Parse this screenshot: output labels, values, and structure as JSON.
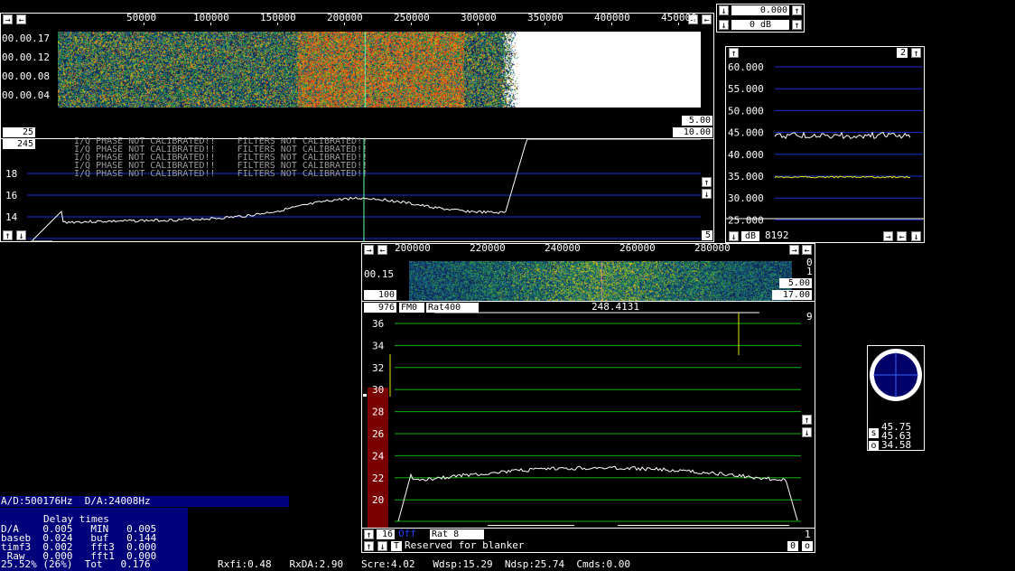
{
  "colors": {
    "grid_blue": "#1a2fd0",
    "grid_green": "#10b010",
    "trace": "#ffffff",
    "yellow_trace": "#e6e600",
    "red_bar": "#7a0000",
    "status_bg": "#00007a",
    "warning_text": "#9a9a9a"
  },
  "wide": {
    "freq_ticks": [
      "50000",
      "100000",
      "150000",
      "200000",
      "250000",
      "300000",
      "350000",
      "400000",
      "450000"
    ],
    "time_labels": [
      "00.00.17",
      "00.00.12",
      "00.00.08",
      "00.00.04"
    ],
    "box_left": "25",
    "box_right_top": "5.00",
    "box_right_bottom": "10.00",
    "box_top_left": "245",
    "warnings": [
      "I/Q PHASE NOT CALIBRATED!!    FILTERS NOT CALIBRATED!!",
      "I/Q PHASE NOT CALIBRATED!!    FILTERS NOT CALIBRATED!!",
      "I/Q PHASE NOT CALIBRATED!!    FILTERS NOT CALIBRATED!!",
      "I/Q PHASE NOT CALIBRATED!!    FILTERS NOT CALIBRATED!!",
      "I/Q PHASE NOT CALIBRATED!!    FILTERS NOT CALIBRATED!!"
    ],
    "y_labels": [
      "18",
      "16",
      "14"
    ],
    "box_bottom_right": "5"
  },
  "top_right": {
    "gain_value": "0.000",
    "db_value": "0 dB"
  },
  "level_graph": {
    "box_top_right": "2",
    "y_labels": [
      "60.000",
      "55.000",
      "50.000",
      "45.000",
      "40.000",
      "35.000",
      "30.000",
      "25.000"
    ],
    "unit": "dB",
    "fft_size": "8192"
  },
  "baseband": {
    "freq_ticks": [
      "200000",
      "220000",
      "240000",
      "260000",
      "280000"
    ],
    "time_label": "00.15",
    "right_marks": [
      "0",
      "1"
    ],
    "box_left": "100",
    "box_right_top": "5.00",
    "box_right_bottom": "17.00",
    "bw_box": "976",
    "mode_box": "FM0",
    "rate_box": "Rat400",
    "freq_readout": "248.4131",
    "right_num": "9",
    "y_labels": [
      "36",
      "34",
      "32",
      "30",
      "28",
      "26",
      "24",
      "22",
      "20"
    ],
    "bottom_box_left": "16",
    "off_label": "Off",
    "bottom_rate": "Rat  8",
    "bottom_right_num": "1",
    "t_button": "T",
    "blanker_text": "Reserved for blanker",
    "zero_box": "0",
    "o_button": "o"
  },
  "meter": {
    "s_label": "s",
    "o_label": "o",
    "values": [
      "45.75",
      "45.63",
      "34.58"
    ]
  },
  "status": {
    "ad_da": "A/D:500176Hz  D/A:24008Hz",
    "delay_title": "Delay times",
    "delay_rows": [
      "D/A    0.005   MIN   0.005",
      "baseb  0.024   buf   0.144",
      "timf3  0.002   fft3  0.000",
      " Raw   0.000   fft1  0.000",
      "25.52% (26%)  Tot   0.176"
    ],
    "bottom_line": "Rxfi:0.48   RxDA:2.90   Scre:4.02   Wdsp:15.29  Ndsp:25.74  Cmds:0.00"
  }
}
